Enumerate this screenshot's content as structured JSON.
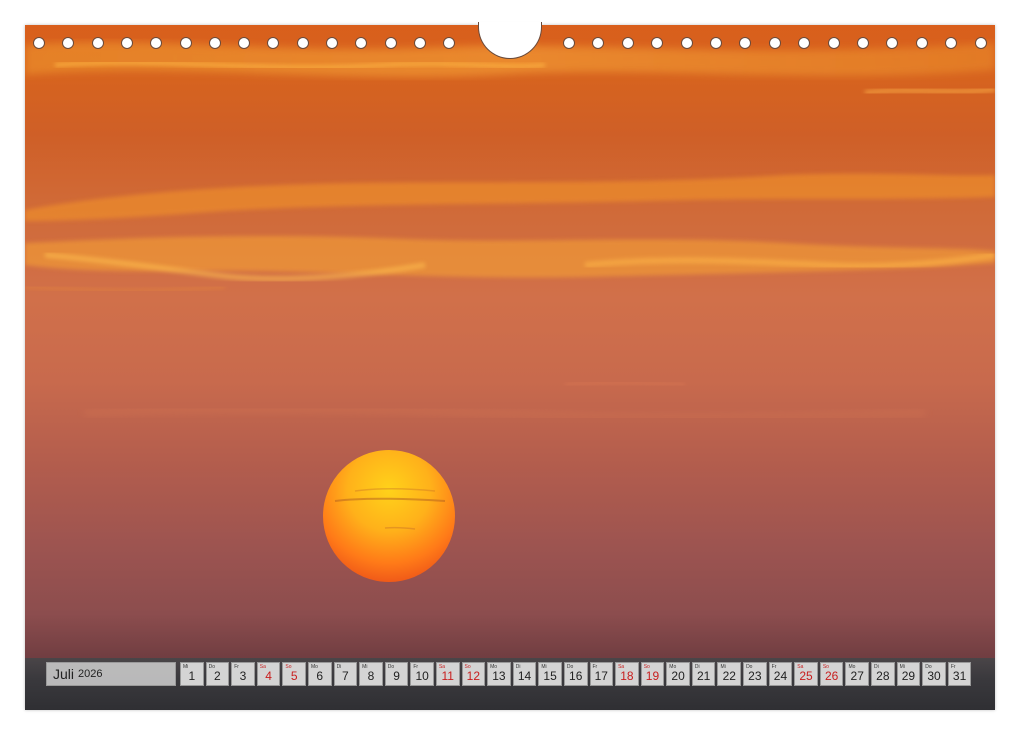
{
  "calendar": {
    "month": "Juli",
    "year": "2026",
    "days": [
      {
        "wd": "Mi",
        "d": "1",
        "we": false
      },
      {
        "wd": "Do",
        "d": "2",
        "we": false
      },
      {
        "wd": "Fr",
        "d": "3",
        "we": false
      },
      {
        "wd": "Sa",
        "d": "4",
        "we": true
      },
      {
        "wd": "So",
        "d": "5",
        "we": true
      },
      {
        "wd": "Mo",
        "d": "6",
        "we": false
      },
      {
        "wd": "Di",
        "d": "7",
        "we": false
      },
      {
        "wd": "Mi",
        "d": "8",
        "we": false
      },
      {
        "wd": "Do",
        "d": "9",
        "we": false
      },
      {
        "wd": "Fr",
        "d": "10",
        "we": false
      },
      {
        "wd": "Sa",
        "d": "11",
        "we": true
      },
      {
        "wd": "So",
        "d": "12",
        "we": true
      },
      {
        "wd": "Mo",
        "d": "13",
        "we": false
      },
      {
        "wd": "Di",
        "d": "14",
        "we": false
      },
      {
        "wd": "Mi",
        "d": "15",
        "we": false
      },
      {
        "wd": "Do",
        "d": "16",
        "we": false
      },
      {
        "wd": "Fr",
        "d": "17",
        "we": false
      },
      {
        "wd": "Sa",
        "d": "18",
        "we": true
      },
      {
        "wd": "So",
        "d": "19",
        "we": true
      },
      {
        "wd": "Mo",
        "d": "20",
        "we": false
      },
      {
        "wd": "Di",
        "d": "21",
        "we": false
      },
      {
        "wd": "Mi",
        "d": "22",
        "we": false
      },
      {
        "wd": "Do",
        "d": "23",
        "we": false
      },
      {
        "wd": "Fr",
        "d": "24",
        "we": false
      },
      {
        "wd": "Sa",
        "d": "25",
        "we": true
      },
      {
        "wd": "So",
        "d": "26",
        "we": true
      },
      {
        "wd": "Mo",
        "d": "27",
        "we": false
      },
      {
        "wd": "Di",
        "d": "28",
        "we": false
      },
      {
        "wd": "Mi",
        "d": "29",
        "we": false
      },
      {
        "wd": "Do",
        "d": "30",
        "we": false
      },
      {
        "wd": "Fr",
        "d": "31",
        "we": false
      }
    ]
  },
  "colors": {
    "weekend": "#c81e1e",
    "sun_core": "#ffd21a",
    "sky_top": "#d95f1c"
  }
}
